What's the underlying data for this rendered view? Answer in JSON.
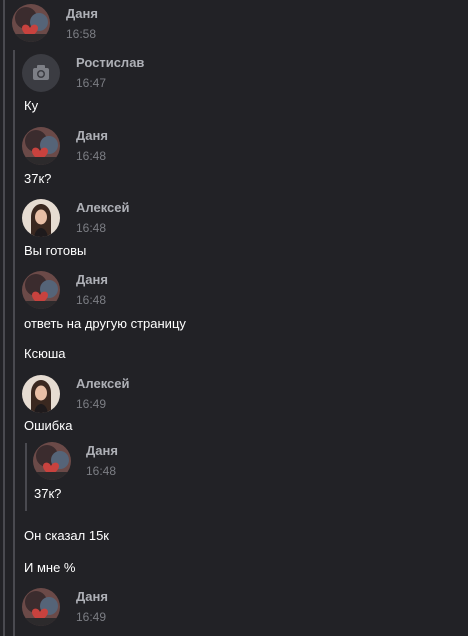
{
  "top": {
    "author": "Даня",
    "time": "16:58"
  },
  "messages": [
    {
      "author": "Ростислав",
      "time": "16:47",
      "texts": [
        "Ку"
      ],
      "avatar": "camera-placeholder"
    },
    {
      "author": "Даня",
      "time": "16:48",
      "texts": [
        "37к?"
      ],
      "avatar": "illustrated-character"
    },
    {
      "author": "Алексей",
      "time": "16:48",
      "texts": [
        "Вы готовы"
      ],
      "avatar": "photo-person"
    },
    {
      "author": "Даня",
      "time": "16:48",
      "texts": [
        "ответь на другую страницу",
        "Ксюша"
      ],
      "avatar": "illustrated-character"
    },
    {
      "author": "Алексей",
      "time": "16:49",
      "texts": [
        "Ошибка",
        "Он сказал 15к",
        "И мне %"
      ],
      "avatar": "photo-person"
    },
    {
      "author": "Даня",
      "time": "16:49",
      "texts": [],
      "avatar": "illustrated-character"
    }
  ],
  "nested_forward": {
    "author": "Даня",
    "time": "16:48",
    "text": "37к?",
    "avatar": "illustrated-character"
  },
  "colors": {
    "background": "#222226",
    "name": "#aeb0b6",
    "time": "#7c7e84",
    "text": "#ffffff",
    "forward_line": "#4a4a50"
  }
}
